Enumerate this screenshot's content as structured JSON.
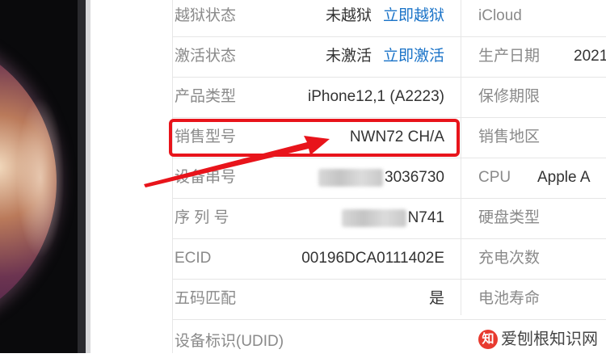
{
  "rows": [
    {
      "label": "越狱状态",
      "value": "未越狱",
      "link": "立即越狱"
    },
    {
      "label": "激活状态",
      "value": "未激活",
      "link": "立即激活"
    },
    {
      "label": "产品类型",
      "value": "iPhone12,1 (A2223)"
    },
    {
      "label": "销售型号",
      "value": "NWN72 CH/A"
    },
    {
      "label": "设备串号",
      "value": "3036730"
    },
    {
      "label": "序 列 号",
      "value": "N741"
    },
    {
      "label": "ECID",
      "value": "00196DCA0111402E"
    },
    {
      "label": "五码匹配",
      "value": "是"
    },
    {
      "label": "设备标识(UDID)",
      "value": ""
    }
  ],
  "right_rows": [
    {
      "label": "iCloud",
      "value": ""
    },
    {
      "label": "生产日期",
      "value": "2021"
    },
    {
      "label": "保修期限",
      "value": ""
    },
    {
      "label": "销售地区",
      "value": ""
    },
    {
      "label": "CPU",
      "value": "Apple A"
    },
    {
      "label": "硬盘类型",
      "value": ""
    },
    {
      "label": "充电次数",
      "value": ""
    },
    {
      "label": "电池寿命",
      "value": ""
    }
  ],
  "watermark": {
    "logo": "知",
    "text": "爱刨根知识网"
  },
  "colors": {
    "highlight": "#e8141b",
    "link": "#1a73c8"
  }
}
